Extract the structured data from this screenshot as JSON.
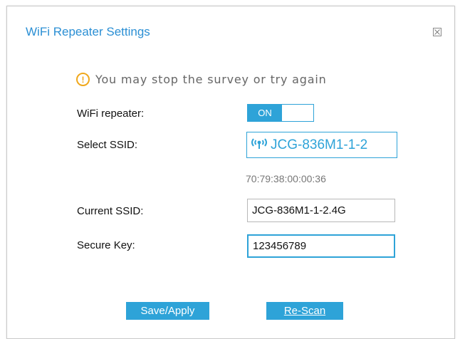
{
  "dialog": {
    "title": "WiFi Repeater Settings",
    "close_icon": "close-icon"
  },
  "notice": {
    "icon": "info-icon",
    "icon_glyph": "!",
    "text": "You may stop the survey or try again",
    "color": "#f0a81c"
  },
  "form": {
    "repeater_label": "WiFi repeater:",
    "repeater_toggle": {
      "state_label": "ON",
      "on": true
    },
    "select_ssid_label": "Select SSID:",
    "selected_ssid": "JCG-836M1-1-2",
    "selected_ssid_icon": "wifi-signal-icon",
    "mac_address": "70:79:38:00:00:36",
    "current_ssid_label": "Current SSID:",
    "current_ssid_value": "JCG-836M1-1-2.4G",
    "secure_key_label": "Secure Key:",
    "secure_key_value": "123456789"
  },
  "buttons": {
    "save_label": "Save/Apply",
    "rescan_label": "Re-Scan"
  },
  "colors": {
    "accent": "#2ea3d8",
    "title": "#2b8fd4"
  }
}
